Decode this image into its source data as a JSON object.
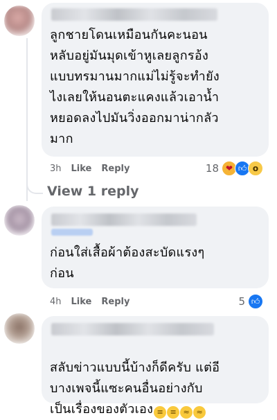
{
  "comments": [
    {
      "text": "ลูกชายโดนเหมือนกันคะนอน\nหลับอยู่มันมุดเข้าหูเลยลูกรอ้ง\nแบบทรมานมากแม่ไม่รู้จะทำยัง\nไงเลยให้นอนตะแคงแล้วเอาน้ำ\nหยอดลงไปมันวิ่งออกมาน่ากลัว\nมาก",
      "time": "3h",
      "like_label": "Like",
      "reply_label": "Reply",
      "reaction_count": "18",
      "reaction_icons": [
        "love-care-icon",
        "like-icon",
        "wow-icon"
      ]
    },
    {
      "text": "ก่อนใส่เสื้อผ้าต้องสะบัดแรงๆ\nก่อน",
      "time": "4h",
      "like_label": "Like",
      "reply_label": "Reply",
      "reaction_count": "5",
      "reaction_icons": [
        "like-icon"
      ]
    },
    {
      "text": "สลับข่าวแบบนี้บ้างก็ดีครับ แต่อี\nบางเพจนี้แซะคนอื่นอย่างกับ\nเป็นเรื่องของตัวเอง",
      "trailing_emojis": [
        "grimace-emoji",
        "grimace-emoji",
        "laughing-emoji",
        "laughing-emoji"
      ]
    }
  ],
  "view_replies": "View 1 reply",
  "colors": {
    "bubble": "#f0f2f5",
    "secondary_text": "#65676b",
    "like_blue": "#1877f2"
  }
}
